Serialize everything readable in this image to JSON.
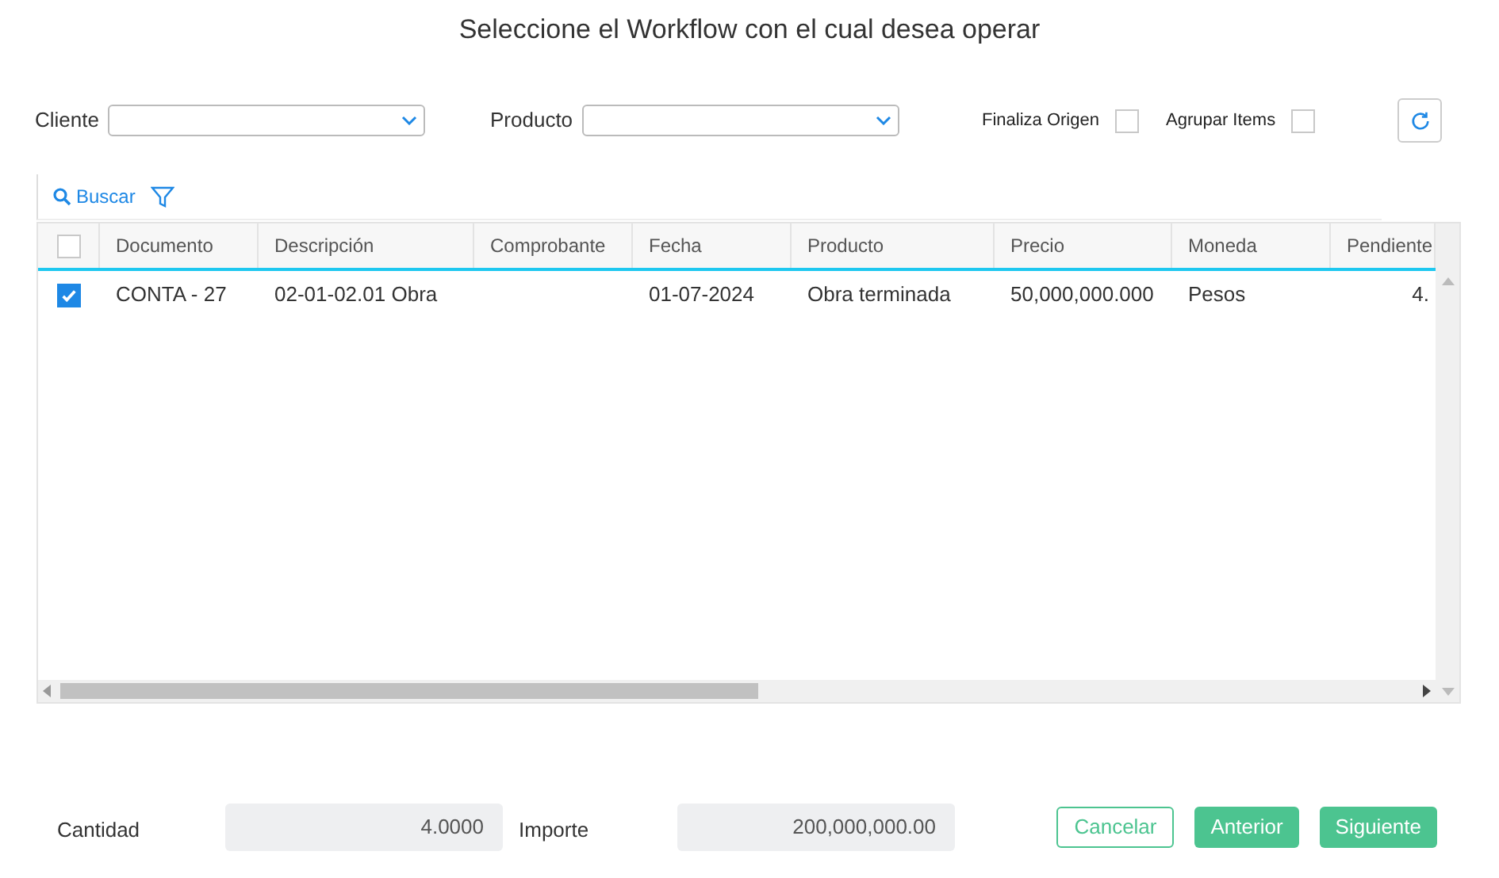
{
  "title": "Seleccione el Workflow con el cual desea operar",
  "filters": [
    {
      "label": "Cliente"
    },
    {
      "label": "Producto"
    }
  ],
  "options": [
    {
      "label": "Finaliza Origen",
      "checked": false
    },
    {
      "label": "Agrupar Items",
      "checked": false
    }
  ],
  "toolbar": {
    "search": "Buscar"
  },
  "table": {
    "columns": [
      "Documento",
      "Descripción",
      "Comprobante",
      "Fecha",
      "Producto",
      "Precio",
      "Moneda",
      "Pendiente"
    ],
    "all_selected": false,
    "rows": [
      {
        "selected": true,
        "cells": [
          "CONTA - 27",
          "02-01-02.01 Obra",
          "",
          "01-07-2024",
          "Obra terminada",
          "50,000,000.000",
          "Pesos",
          "4."
        ]
      }
    ]
  },
  "totals": [
    {
      "label": "Cantidad",
      "value": "4.0000"
    },
    {
      "label": "Importe",
      "value": "200,000,000.00"
    }
  ],
  "buttons": [
    {
      "label": "Cancelar",
      "kind": "outline"
    },
    {
      "label": "Anterior",
      "kind": "filled"
    },
    {
      "label": "Siguiente",
      "kind": "filled"
    }
  ]
}
